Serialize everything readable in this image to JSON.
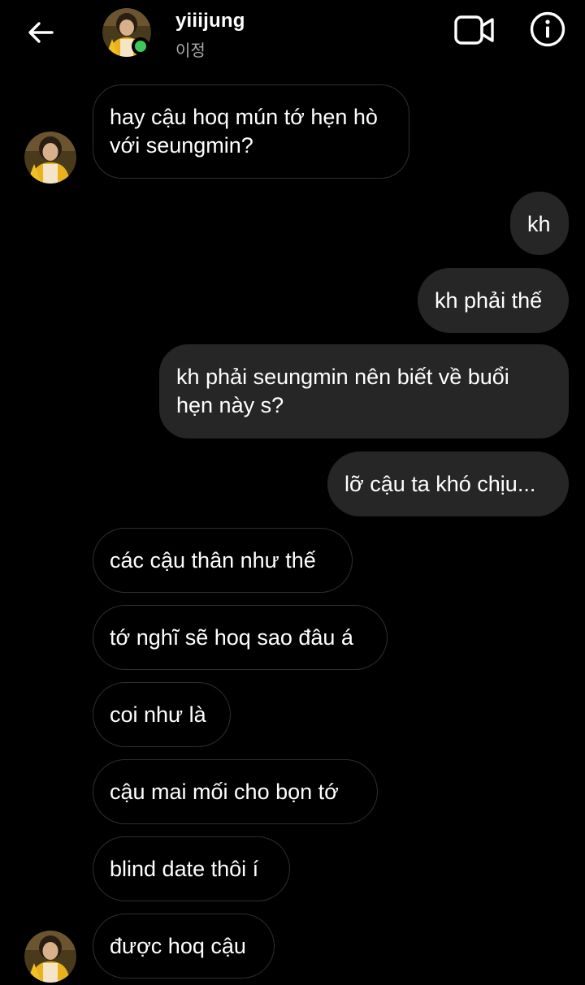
{
  "header": {
    "username": "yiiijung",
    "subname": "이정",
    "status_color": "#3cc85a",
    "back_icon": "back-arrow-icon",
    "video_icon": "video-camera-icon",
    "info_icon": "info-icon"
  },
  "messages": [
    {
      "direction": "incoming",
      "text": "hay cậu hoq mún tớ hẹn hò với seungmin?",
      "avatar": true
    },
    {
      "direction": "outgoing",
      "text": "kh"
    },
    {
      "direction": "outgoing",
      "text": "kh phải thế"
    },
    {
      "direction": "outgoing",
      "text": "kh phải seungmin nên biết về buổi hẹn này s?"
    },
    {
      "direction": "outgoing",
      "text": "lỡ cậu ta khó chịu..."
    },
    {
      "direction": "incoming",
      "text": "các cậu thân như thế"
    },
    {
      "direction": "incoming",
      "text": "tớ nghĩ sẽ hoq sao đâu á"
    },
    {
      "direction": "incoming",
      "text": "coi như là"
    },
    {
      "direction": "incoming",
      "text": "cậu mai mối cho bọn tớ"
    },
    {
      "direction": "incoming",
      "text": "blind date thôi í"
    },
    {
      "direction": "incoming",
      "text": "được hoq cậu",
      "avatar": true
    }
  ],
  "colors": {
    "background": "#000000",
    "outgoing_bubble": "#262626",
    "incoming_border": "#2f2f2f"
  }
}
